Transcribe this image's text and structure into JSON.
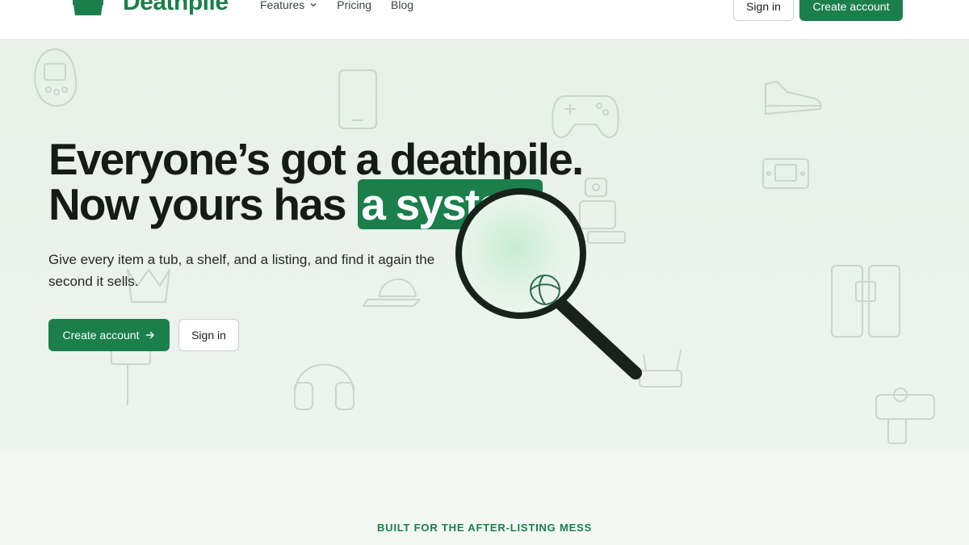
{
  "brand": {
    "name": "Deathpile",
    "color": "#1a7f4b"
  },
  "nav": {
    "items": [
      {
        "label": "Features",
        "has_dropdown": true
      },
      {
        "label": "Pricing"
      },
      {
        "label": "Blog"
      }
    ],
    "sign_in_label": "Sign in",
    "create_account_label": "Create account"
  },
  "hero": {
    "headline_line1": "Everyone’s got a deathpile.",
    "headline_line2_prefix": "Now yours has ",
    "headline_highlight": "a system",
    "headline_line2_suffix": ".",
    "subtext": "Give every item a tub, a shelf, and a listing, and find it again the second it sells.",
    "primary_cta": "Create account",
    "primary_cta_icon": "arrow-right-icon",
    "secondary_cta": "Sign in",
    "illustration": "magnifying-glass-icon"
  },
  "section": {
    "eyebrow": "BUILT FOR THE AFTER-LISTING MESS"
  }
}
